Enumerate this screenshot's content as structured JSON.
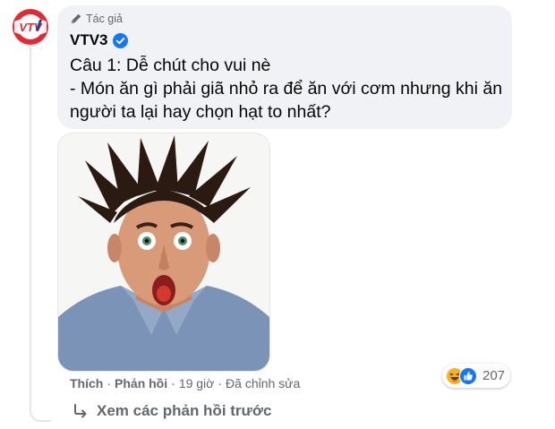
{
  "comment": {
    "author_badge": "Tác giả",
    "author_name": "VTV3",
    "text_line1": "Câu 1: Dễ chút cho vui nè",
    "text_line2": "- Món ăn gì phải giã nhỏ ra để ăn với cơm nhưng khi ăn người ta lại hay chọn hạt to nhất?",
    "avatar_logo": "VTV",
    "image": "surprised-man-spiky-hair-photo"
  },
  "actions": {
    "like": "Thích",
    "reply": "Phản hồi",
    "time": "19 giờ",
    "edited": "Đã chỉnh sửa",
    "separator": "·"
  },
  "reactions": {
    "icons": [
      "haha-icon",
      "like-icon"
    ],
    "count": "207"
  },
  "view_previous": {
    "label": "Xem các phản hồi trước",
    "icon": "reply-arrow-icon"
  },
  "colors": {
    "bubble_bg": "#f0f2f5",
    "secondary_text": "#65676b",
    "verified_blue": "#1877f2",
    "thread_line": "#e4e6eb"
  }
}
